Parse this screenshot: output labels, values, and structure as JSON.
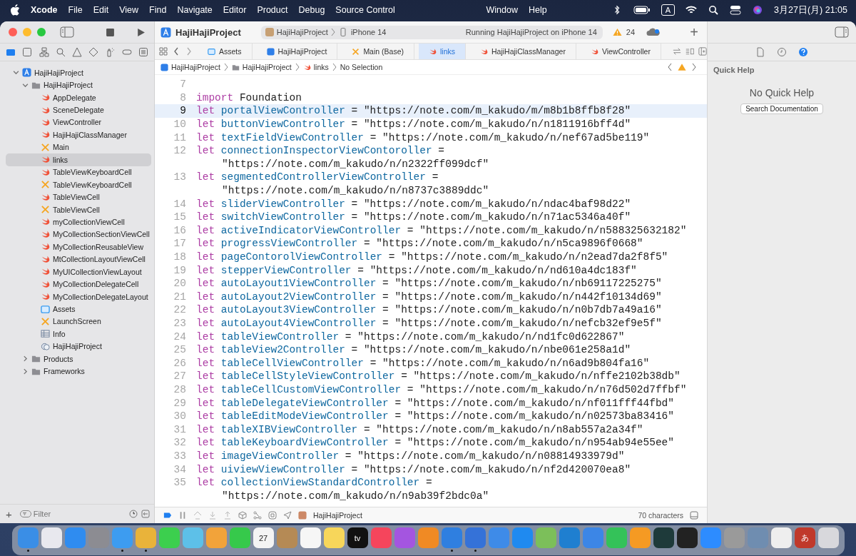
{
  "menu_bar": {
    "app": "Xcode",
    "items": [
      "File",
      "Edit",
      "View",
      "Find",
      "Navigate",
      "Editor",
      "Product",
      "Debug",
      "Source Control"
    ],
    "right_items": [
      "Window",
      "Help"
    ],
    "input_mode": "A",
    "clock": "3月27日(月)  21:05"
  },
  "toolbar": {
    "project": "HajiHajiProject",
    "scheme": "HajiHajiProject",
    "device": "iPhone 14",
    "status": "Running HajiHajiProject on iPhone 14",
    "warnings": "24",
    "add": "+"
  },
  "tabs": [
    {
      "label": "Assets",
      "kind": "assets",
      "selected": false
    },
    {
      "label": "HajiHajiProject",
      "kind": "project",
      "selected": false
    },
    {
      "label": "Main (Base)",
      "kind": "xib",
      "selected": false
    },
    {
      "label": "links",
      "kind": "swift",
      "selected": true
    },
    {
      "label": "HajiHajiClassManager",
      "kind": "swift",
      "selected": false
    },
    {
      "label": "ViewController",
      "kind": "swift",
      "selected": false
    }
  ],
  "jump_bar": [
    {
      "label": "HajiHajiProject",
      "kind": "project"
    },
    {
      "label": "HajiHajiProject",
      "kind": "folder"
    },
    {
      "label": "links",
      "kind": "swift"
    },
    {
      "label": "No Selection",
      "kind": "none"
    }
  ],
  "navigator": {
    "tree": [
      {
        "label": "HajiHajiProject",
        "kind": "project",
        "expanded": true,
        "selected": false,
        "children": [
          {
            "label": "HajiHajiProject",
            "kind": "folder",
            "expanded": true,
            "selected": false,
            "children": [
              {
                "label": "AppDelegate",
                "kind": "swift",
                "selected": false
              },
              {
                "label": "SceneDelegate",
                "kind": "swift",
                "selected": false
              },
              {
                "label": "ViewController",
                "kind": "swift",
                "selected": false
              },
              {
                "label": "HajiHajiClassManager",
                "kind": "swift",
                "selected": false
              },
              {
                "label": "Main",
                "kind": "xib",
                "selected": false
              },
              {
                "label": "links",
                "kind": "swift",
                "selected": true
              },
              {
                "label": "TableViewKeyboardCell",
                "kind": "swift",
                "selected": false
              },
              {
                "label": "TableViewKeyboardCell",
                "kind": "xib",
                "selected": false
              },
              {
                "label": "TableViewCell",
                "kind": "swift",
                "selected": false
              },
              {
                "label": "TableViewCell",
                "kind": "xib",
                "selected": false
              },
              {
                "label": "myCollectionViewCell",
                "kind": "swift",
                "selected": false
              },
              {
                "label": "MyCollectionSectionViewCell",
                "kind": "swift",
                "selected": false
              },
              {
                "label": "MyCollectionReusableView",
                "kind": "swift",
                "selected": false
              },
              {
                "label": "MtCollectionLayoutViewCell",
                "kind": "swift",
                "selected": false
              },
              {
                "label": "MyUICollectionViewLayout",
                "kind": "swift",
                "selected": false
              },
              {
                "label": "MyCollectionDelegateCell",
                "kind": "swift",
                "selected": false
              },
              {
                "label": "MyCollectionDelegateLayout",
                "kind": "swift",
                "selected": false
              },
              {
                "label": "Assets",
                "kind": "assets",
                "selected": false
              },
              {
                "label": "LaunchScreen",
                "kind": "xib",
                "selected": false
              },
              {
                "label": "Info",
                "kind": "plist",
                "selected": false
              },
              {
                "label": "HajiHajiProject",
                "kind": "entitlements",
                "selected": false
              }
            ]
          },
          {
            "label": "Products",
            "kind": "folder",
            "expanded": false,
            "selected": false
          },
          {
            "label": "Frameworks",
            "kind": "folder",
            "expanded": false,
            "selected": false
          }
        ]
      }
    ],
    "filter_placeholder": "Filter",
    "add": "+"
  },
  "code": [
    {
      "number": "7",
      "highlighted": false
    },
    {
      "number": "8",
      "keyword": "import",
      "name": "Foundation",
      "highlighted": false
    },
    {
      "number": "9",
      "keyword": "let",
      "name": "portalViewController",
      "operator": "=",
      "string": "\"https://note.com/m_kakudo/m/m8b1b8ffb8f28\"",
      "wrap": false,
      "highlighted": true
    },
    {
      "number": "10",
      "keyword": "let",
      "name": "buttonViewController",
      "operator": "=",
      "string": "\"https://note.com/m_kakudo/n/n1811916bff4d\"",
      "wrap": false,
      "highlighted": false
    },
    {
      "number": "11",
      "keyword": "let",
      "name": "textFieldViewController",
      "operator": "=",
      "string": "\"https://note.com/m_kakudo/n/nef67ad5be119\"",
      "wrap": false,
      "highlighted": false
    },
    {
      "number": "12",
      "keyword": "let",
      "name": "connectionInspectorViewContoroller",
      "operator": "=",
      "string": "\"https://note.com/m_kakudo/n/n2322ff099dcf\"",
      "wrap": true,
      "highlighted": false
    },
    {
      "number": "13",
      "keyword": "let",
      "name": "segmentedControllerViewController",
      "operator": "=",
      "string": "\"https://note.com/m_kakudo/n/n8737c3889ddc\"",
      "wrap": true,
      "highlighted": false
    },
    {
      "number": "14",
      "keyword": "let",
      "name": "sliderViewController",
      "operator": "=",
      "string": "\"https://note.com/m_kakudo/n/ndac4baf98d22\"",
      "wrap": false,
      "highlighted": false
    },
    {
      "number": "15",
      "keyword": "let",
      "name": "switchViewController",
      "operator": "=",
      "string": "\"https://note.com/m_kakudo/n/n71ac5346a40f\"",
      "wrap": false,
      "highlighted": false
    },
    {
      "number": "16",
      "keyword": "let",
      "name": "activeIndicatorViewController",
      "operator": "=",
      "string": "\"https://note.com/m_kakudo/n/n588325632182\"",
      "wrap": false,
      "highlighted": false
    },
    {
      "number": "17",
      "keyword": "let",
      "name": "progressViewController",
      "operator": "=",
      "string": "\"https://note.com/m_kakudo/n/n5ca9896f0668\"",
      "wrap": false,
      "highlighted": false
    },
    {
      "number": "18",
      "keyword": "let",
      "name": "pageContorolViewController",
      "operator": "=",
      "string": "\"https://note.com/m_kakudo/n/n2ead7da2f8f5\"",
      "wrap": false,
      "highlighted": false
    },
    {
      "number": "19",
      "keyword": "let",
      "name": "stepperViewController",
      "operator": "=",
      "string": "\"https://note.com/m_kakudo/n/nd610a4dc183f\"",
      "wrap": false,
      "highlighted": false
    },
    {
      "number": "20",
      "keyword": "let",
      "name": "autoLayout1ViewController",
      "operator": "=",
      "string": "\"https://note.com/m_kakudo/n/nb69117225275\"",
      "wrap": false,
      "highlighted": false
    },
    {
      "number": "21",
      "keyword": "let",
      "name": "autoLayout2ViewController",
      "operator": "=",
      "string": "\"https://note.com/m_kakudo/n/n442f10134d69\"",
      "wrap": false,
      "highlighted": false
    },
    {
      "number": "22",
      "keyword": "let",
      "name": "autoLayout3ViewController",
      "operator": "=",
      "string": "\"https://note.com/m_kakudo/n/n0b7db7a49a16\"",
      "wrap": false,
      "highlighted": false
    },
    {
      "number": "23",
      "keyword": "let",
      "name": "autoLayout4ViewController",
      "operator": "=",
      "string": "\"https://note.com/m_kakudo/n/nefcb32ef9e5f\"",
      "wrap": false,
      "highlighted": false
    },
    {
      "number": "24",
      "keyword": "let",
      "name": "tableViewController",
      "operator": "=",
      "string": "\"https://note.com/m_kakudo/n/nd1fc0d622867\"",
      "wrap": false,
      "highlighted": false
    },
    {
      "number": "25",
      "keyword": "let",
      "name": "tableView2Controller",
      "operator": "=",
      "string": "\"https://note.com/m_kakudo/n/nbe061e258a1d\"",
      "wrap": false,
      "highlighted": false
    },
    {
      "number": "26",
      "keyword": "let",
      "name": "tableCellViewController",
      "operator": "=",
      "string": "\"https://note.com/m_kakudo/n/n6ad9b804fa16\"",
      "wrap": false,
      "highlighted": false
    },
    {
      "number": "27",
      "keyword": "let",
      "name": "tableCellStyleViewController",
      "operator": "=",
      "string": "\"https://note.com/m_kakudo/n/nffe2102b38db\"",
      "wrap": false,
      "highlighted": false
    },
    {
      "number": "28",
      "keyword": "let",
      "name": "tableCellCustomViewController",
      "operator": "=",
      "string": "\"https://note.com/m_kakudo/n/n76d502d7ffbf\"",
      "wrap": false,
      "highlighted": false
    },
    {
      "number": "29",
      "keyword": "let",
      "name": "tableDelegateViewController",
      "operator": "=",
      "string": "\"https://note.com/m_kakudo/n/nf011fff44fbd\"",
      "wrap": false,
      "highlighted": false
    },
    {
      "number": "30",
      "keyword": "let",
      "name": "tableEditModeViewController",
      "operator": "=",
      "string": "\"https://note.com/m_kakudo/n/n02573ba83416\"",
      "wrap": false,
      "highlighted": false
    },
    {
      "number": "31",
      "keyword": "let",
      "name": "tableXIBViewController",
      "operator": "=",
      "string": "\"https://note.com/m_kakudo/n/n8ab557a2a34f\"",
      "wrap": false,
      "highlighted": false
    },
    {
      "number": "32",
      "keyword": "let",
      "name": "tableKeyboardViewController",
      "operator": "=",
      "string": "\"https://note.com/m_kakudo/n/n954ab94e55ee\"",
      "wrap": false,
      "highlighted": false
    },
    {
      "number": "33",
      "keyword": "let",
      "name": "imageViewController",
      "operator": "=",
      "string": "\"https://note.com/m_kakudo/n/n08814933979d\"",
      "wrap": false,
      "highlighted": false
    },
    {
      "number": "34",
      "keyword": "let",
      "name": "uiviewViewController",
      "operator": "=",
      "string": "\"https://note.com/m_kakudo/n/nf2d420070ea8\"",
      "wrap": false,
      "highlighted": false
    },
    {
      "number": "35",
      "keyword": "let",
      "name": "collectionViewStandardController",
      "operator": "=",
      "string": "\"https://note.com/m_kakudo/n/n9ab39f2bdc0a\"",
      "wrap": true,
      "highlighted": false
    }
  ],
  "debug_bar": {
    "target": "HajiHajiProject",
    "characters": "70 characters"
  },
  "inspector": {
    "title": "Quick Help",
    "empty": "No Quick Help",
    "button": "Search Documentation"
  },
  "dock": [
    {
      "color": "#3a8ee6",
      "running": true
    },
    {
      "color": "#e8e8ee",
      "running": false
    },
    {
      "color": "#2f8cf0",
      "running": false
    },
    {
      "color": "#8c8c92",
      "running": false
    },
    {
      "color": "#3d9cf0",
      "running": true
    },
    {
      "color": "#e9b33a",
      "running": true
    },
    {
      "color": "#3ccf4e",
      "running": false
    },
    {
      "color": "#5dc0e8",
      "running": false
    },
    {
      "color": "#f2a33a",
      "running": false
    },
    {
      "color": "#36c94b",
      "running": false
    },
    {
      "color": "#f4f4f4",
      "running": false,
      "label": "27"
    },
    {
      "color": "#b58a55",
      "running": false
    },
    {
      "color": "#f6f6f6",
      "running": false
    },
    {
      "color": "#f7d65a",
      "running": false
    },
    {
      "color": "#111111",
      "running": false,
      "label": "tv"
    },
    {
      "color": "#f5455c",
      "running": false
    },
    {
      "color": "#a455e0",
      "running": false
    },
    {
      "color": "#f08a24",
      "running": false
    },
    {
      "color": "#2f7fe0",
      "running": true
    },
    {
      "color": "#3572d8",
      "running": true
    },
    {
      "color": "#3e8be8",
      "running": false
    },
    {
      "color": "#1f8af0",
      "running": false
    },
    {
      "color": "#7cbf5a",
      "running": false
    },
    {
      "color": "#1f7fd0",
      "running": false
    },
    {
      "color": "#3c86e6",
      "running": false
    },
    {
      "color": "#34c259",
      "running": false
    },
    {
      "color": "#f59a23",
      "running": false
    },
    {
      "color": "#1e3a3a",
      "running": false
    },
    {
      "color": "#222222",
      "running": false
    },
    {
      "color": "#2d8cff",
      "running": false
    },
    {
      "color": "#9a9a9a",
      "running": false
    },
    {
      "color": "#6f8db0",
      "running": false
    },
    {
      "color": "#eeeeee",
      "running": false
    },
    {
      "color": "#c0392b",
      "running": false,
      "label": "あ"
    },
    {
      "color": "#d8d8dc",
      "running": false
    }
  ]
}
